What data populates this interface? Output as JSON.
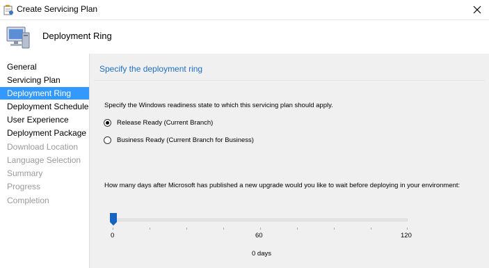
{
  "window": {
    "title": "Create Servicing Plan",
    "close_glyph": "✕"
  },
  "header": {
    "title": "Deployment Ring",
    "icon": "computer-icon"
  },
  "sidebar": {
    "items": [
      {
        "label": "General",
        "state": "enabled"
      },
      {
        "label": "Servicing Plan",
        "state": "enabled"
      },
      {
        "label": "Deployment Ring",
        "state": "active"
      },
      {
        "label": "Deployment Schedule",
        "state": "enabled"
      },
      {
        "label": "User Experience",
        "state": "enabled"
      },
      {
        "label": "Deployment Package",
        "state": "enabled"
      },
      {
        "label": "Download Location",
        "state": "disabled"
      },
      {
        "label": "Language Selection",
        "state": "disabled"
      },
      {
        "label": "Summary",
        "state": "disabled"
      },
      {
        "label": "Progress",
        "state": "disabled"
      },
      {
        "label": "Completion",
        "state": "disabled"
      }
    ]
  },
  "main": {
    "section_title": "Specify the deployment ring",
    "readiness_prompt": "Specify the Windows readiness state to which this servicing plan should apply.",
    "options": [
      {
        "label": "Release Ready (Current Branch)",
        "checked": true
      },
      {
        "label": "Business Ready (Current Branch for Business)",
        "checked": false
      }
    ],
    "days_question": "How many days after Microsoft has published a new upgrade would you like to wait before deploying in your environment:",
    "slider": {
      "min_label": "0",
      "mid_label": "60",
      "max_label": "120",
      "value": 0,
      "value_text": "0 days"
    }
  },
  "colors": {
    "accent": "#3399ff",
    "section_title": "#1c6fc4",
    "disabled_text": "#9a9a9a",
    "panel_bg": "#f0f0f0",
    "slider_thumb": "#1565c0"
  }
}
